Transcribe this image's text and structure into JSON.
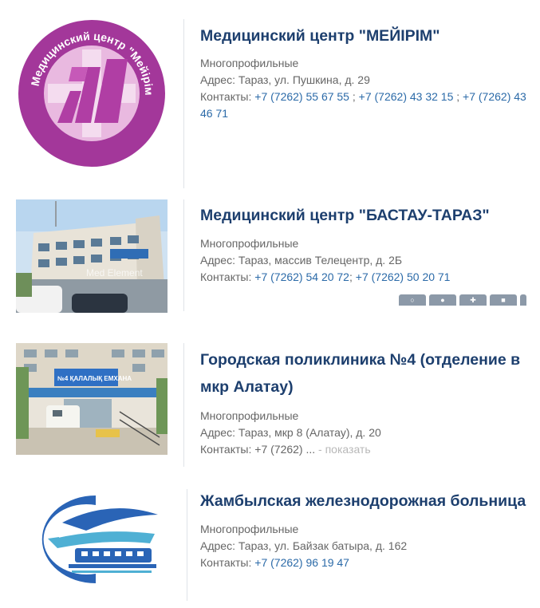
{
  "colors": {
    "title": "#1d3f6e",
    "link": "#2b6aa8",
    "text": "#666666",
    "muted": "#b8b8b8"
  },
  "clinics": [
    {
      "name": "Медицинский центр \"МЕЙІРІМ\"",
      "logo_text": "Медицинский центр \"Мейірім\"",
      "category": "Многопрофильные",
      "address_label": "Адрес:",
      "address": "Тараз, ул. Пушкина, д. 29",
      "contacts_label": "Контакты:",
      "phones": [
        "+7 (7262) 55 67 55",
        "+7 (7262) 43 32 15",
        "+7 (7262) 43 46 71"
      ]
    },
    {
      "name": "Медицинский центр \"БАСТАУ-ТАРАЗ\"",
      "category": "Многопрофильные",
      "address_label": "Адрес:",
      "address": "Тараз, массив Телецентр, д. 2Б",
      "contacts_label": "Контакты:",
      "phones": [
        "+7 (7262) 54 20 72",
        "+7 (7262) 50 20 71"
      ],
      "photo_watermark": "Med Element",
      "badge_icons": [
        "mouse-icon",
        "person-icon",
        "first-aid-icon",
        "ambulance-icon",
        "more-icon"
      ]
    },
    {
      "name": "Городская поликлиника №4 (отделение в мкр Алатау)",
      "category": "Многопрофильные",
      "address_label": "Адрес:",
      "address": "Тараз, мкр 8 (Алатау), д. 20",
      "contacts_label": "Контакты:",
      "phone_partial": "+7 (7262) ...",
      "show_more": "- показать",
      "photo_sign": "№4 ҚАЛАЛЫҚ ЕМХАНА"
    },
    {
      "name": "Жамбылская железнодорожная больница",
      "category": "Многопрофильные",
      "address_label": "Адрес:",
      "address": "Тараз, ул. Байзак батыра, д. 162",
      "contacts_label": "Контакты:",
      "phones": [
        "+7 (7262) 96 19 47"
      ]
    }
  ]
}
